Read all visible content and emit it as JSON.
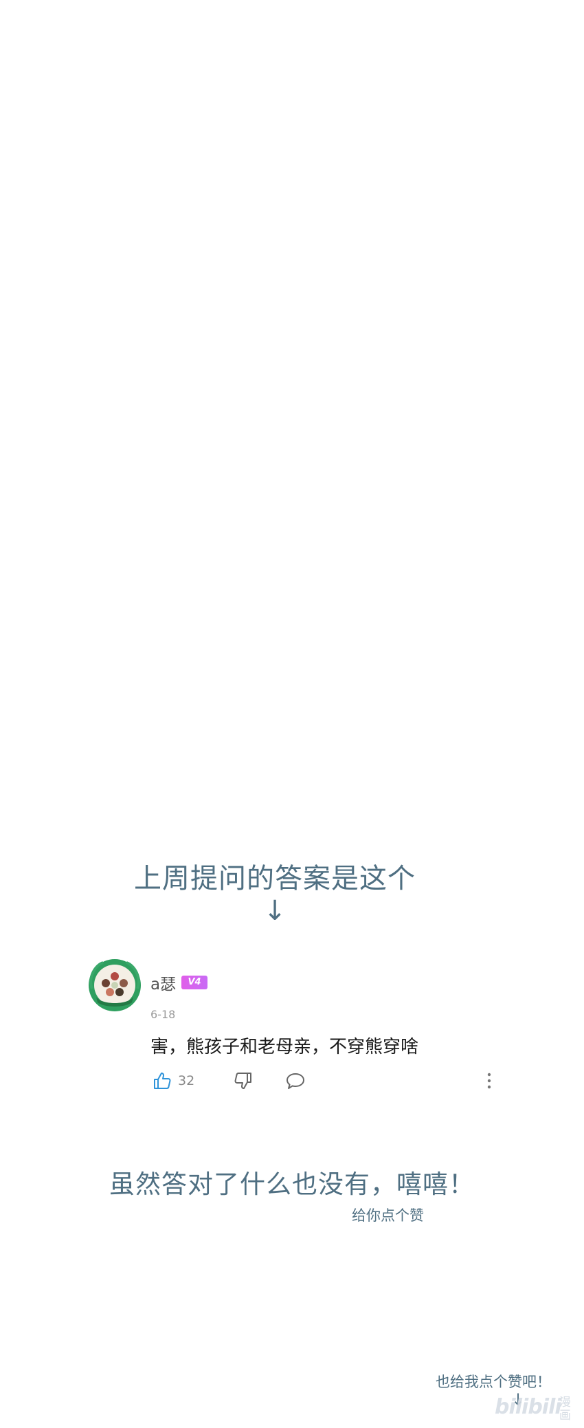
{
  "post": {
    "heading": "上周提问的答案是这个",
    "heading_arrow": "↓",
    "closing_line": "虽然答对了什么也没有，嘻嘻！",
    "like_plea": "给你点个赞",
    "corner_text": "也给我点个赞吧！",
    "corner_arrow": "↓"
  },
  "comment": {
    "username": "a瑟",
    "level_badge": "V4",
    "date": "6-18",
    "text": "害，熊孩子和老母亲，不穿熊穿啥",
    "like_count": "32",
    "icons": {
      "like": "thumbs-up-icon",
      "dislike": "thumbs-down-icon",
      "reply": "reply-icon",
      "more": "more-vertical-icon"
    }
  },
  "watermark": {
    "logo": "bilibili",
    "label": "漫画"
  },
  "colors": {
    "caption": "#4f6f82",
    "like_icon": "#2e93d9",
    "level_badge": "#d766f0",
    "avatar_ring": "#2f9f5f",
    "watermark": "#d0d7df"
  }
}
